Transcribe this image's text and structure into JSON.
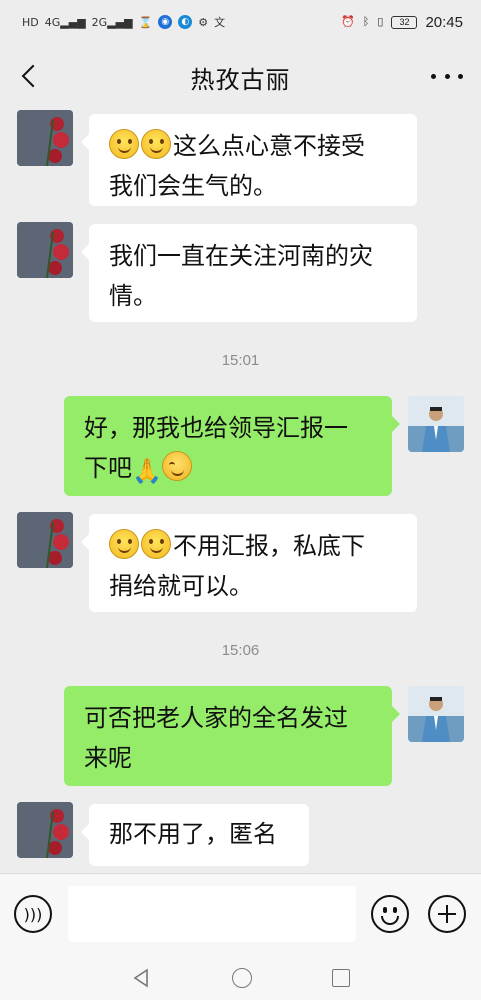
{
  "status_bar": {
    "signal_left": "HD",
    "net1": "4G",
    "net2": "2G",
    "battery": "32",
    "time": "20:45",
    "icons": [
      "hd-icon",
      "signal-icon",
      "hourglass-icon",
      "app-badge-icon",
      "alarm-icon",
      "bluetooth-icon",
      "vibrate-icon",
      "battery-icon"
    ]
  },
  "header": {
    "title": "热孜古丽",
    "back_icon": "chevron-left-icon",
    "more_icon": "more-dots-icon"
  },
  "messages": [
    {
      "side": "in",
      "avatar": "rose-avatar",
      "emojis": [
        "smile-emoji",
        "smile-emoji"
      ],
      "line1": "这么点心意不接受",
      "line2": "我们会生气的。"
    },
    {
      "side": "in",
      "avatar": "rose-avatar",
      "line1": "我们一直在关注河南的灾",
      "line2": "情。"
    },
    {
      "side": "time",
      "text": "15:01"
    },
    {
      "side": "out",
      "avatar": "man-avatar",
      "line1": "好，那我也给领导汇报一",
      "line2": "下吧"
    },
    {
      "side": "in",
      "avatar": "rose-avatar",
      "emojis": [
        "smile-emoji",
        "smile-emoji"
      ],
      "line1": "不用汇报，私底下",
      "line2": "捐给就可以。"
    },
    {
      "side": "time",
      "text": "15:06"
    },
    {
      "side": "out",
      "avatar": "man-avatar",
      "line1": "可否把老人家的全名发过",
      "line2": "来呢"
    },
    {
      "side": "in",
      "avatar": "rose-avatar",
      "line1": "那不用了，匿名"
    }
  ],
  "input_bar": {
    "voice_icon": "voice-icon",
    "placeholder": "",
    "emoji_icon": "emoji-icon",
    "plus_icon": "plus-icon"
  },
  "colors": {
    "background": "#ededed",
    "outgoing_bubble": "#95ec69",
    "incoming_bubble": "#ffffff",
    "timestamp": "#8c8c8c"
  }
}
